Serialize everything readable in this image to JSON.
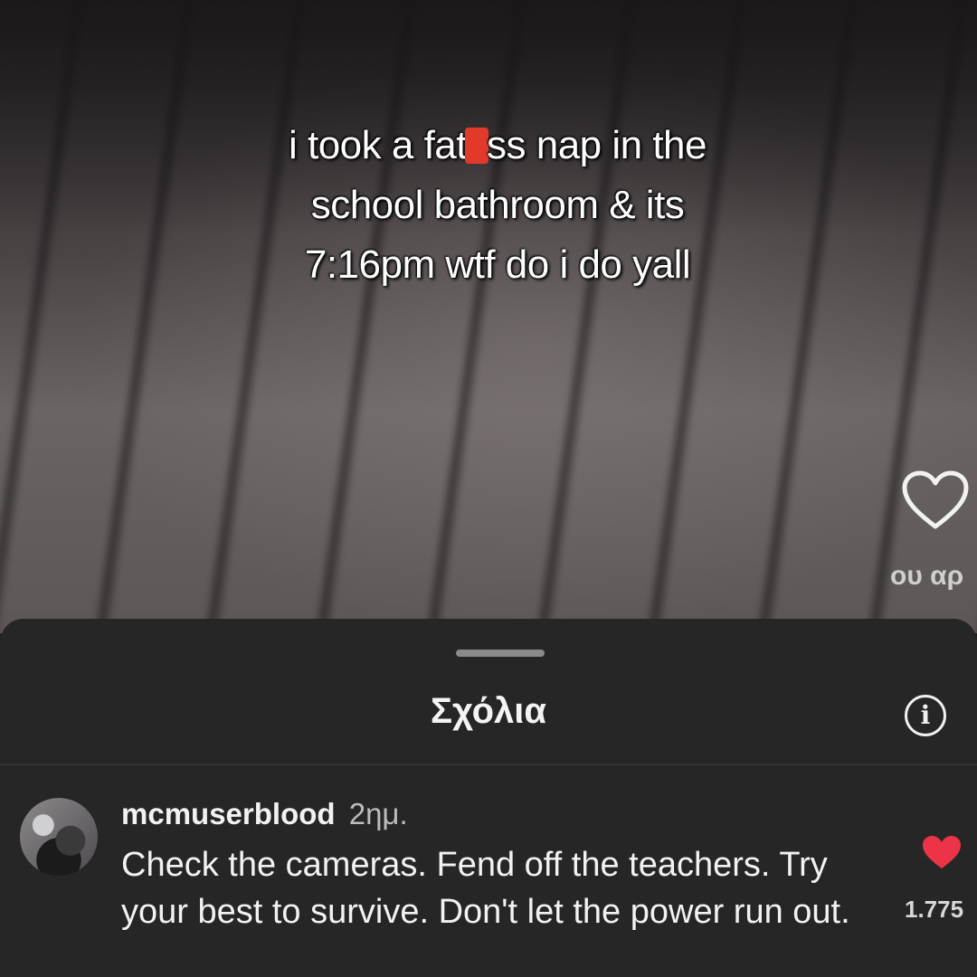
{
  "video": {
    "caption_lines": [
      "i took a fat",
      "ss nap in the",
      "school bathroom & its",
      "7:16pm wtf do i do yall"
    ],
    "side_text": "ου αρ",
    "heart_icon": "heart-outline-icon"
  },
  "comments_sheet": {
    "title": "Σχόλια",
    "info_label": "i",
    "comments": [
      {
        "username": "mcmuserblood",
        "time": "2ημ.",
        "text": "Check the cameras. Fend off the teachers. Try your best to survive. Don't let the power run out.",
        "like_count": "1.775",
        "liked": true,
        "like_color": "#ed3347"
      }
    ]
  },
  "colors": {
    "sheet_background": "#262626",
    "censor_mark": "#e23a2a"
  }
}
